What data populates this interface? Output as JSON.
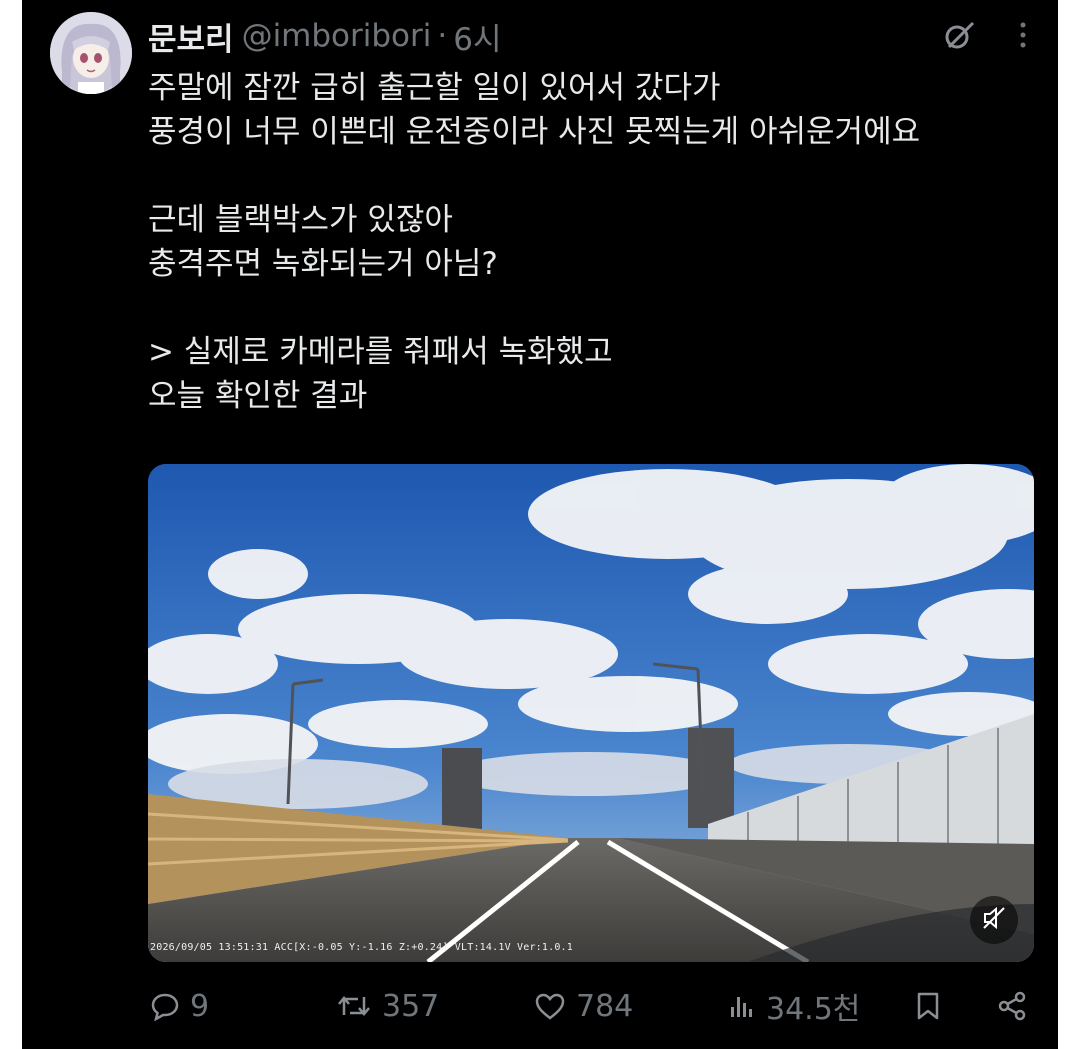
{
  "post": {
    "author": {
      "display_name": "문보리",
      "handle": "@imboribori",
      "separator": "·",
      "time": "6시"
    },
    "text_lines": [
      "주말에 잠깐 급히 출근할 일이 있어서 갔다가",
      "풍경이 너무 이쁜데 운전중이라 사진 못찍는게 아쉬운거에요",
      "",
      "근데 블랙박스가 있잖아",
      "충격주면 녹화되는거 아님?",
      "",
      "> 실제로 카메라를 줘패서 녹화했고",
      "오늘 확인한 결과"
    ],
    "media": {
      "overlay_text": "2026/09/05 13:51:31 ACC[X:-0.05 Y:-1.16 Z:+0.24] VLT:14.1V Ver:1.0.1",
      "mute_icon": "speaker-muted-icon"
    },
    "stats": {
      "replies": "9",
      "reposts": "357",
      "likes": "784",
      "views": "34.5천"
    }
  },
  "colors": {
    "background": "#000000",
    "text": "#e7e9ea",
    "secondary_text": "#71767b"
  },
  "icons": [
    "grok-icon",
    "more-icon",
    "reply-icon",
    "repost-icon",
    "like-icon",
    "views-icon",
    "bookmark-icon",
    "share-icon"
  ]
}
